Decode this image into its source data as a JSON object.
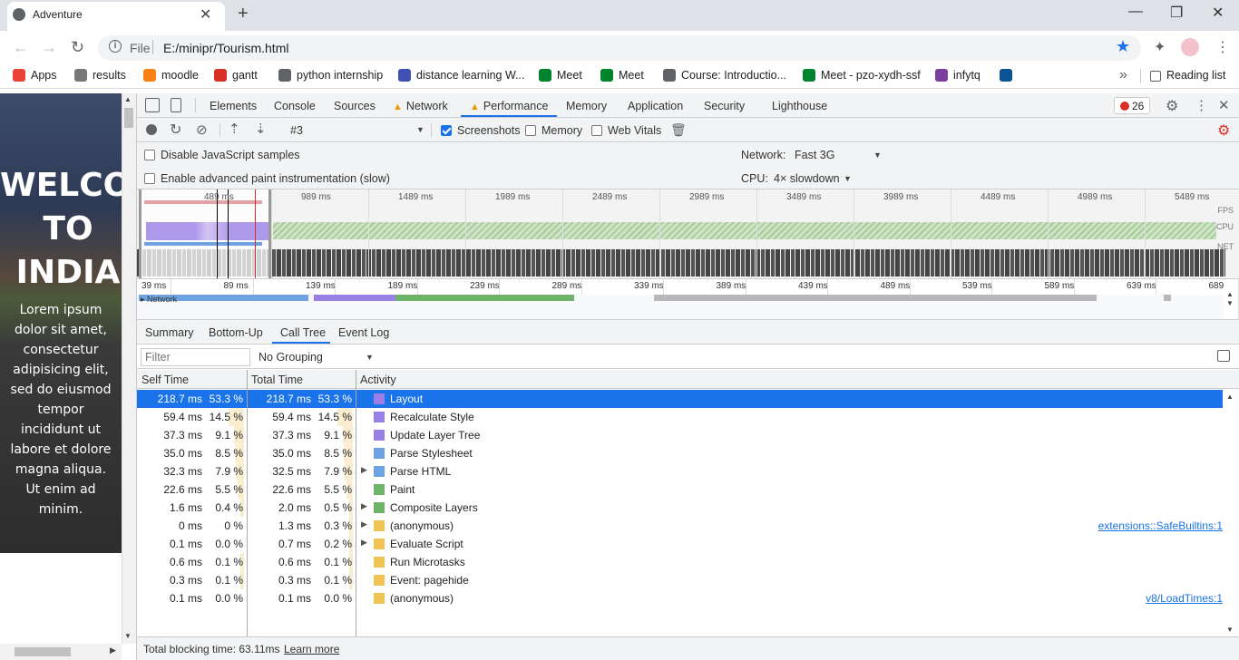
{
  "browser": {
    "tab_title": "Adventure",
    "tab_close": "✕",
    "new_tab": "+",
    "window_min": "—",
    "window_restore": "❐",
    "window_close": "✕",
    "url_scheme": "File",
    "url": "E:/minipr/Tourism.html",
    "bookmarks": [
      {
        "label": "Apps",
        "color": "#ea4335"
      },
      {
        "label": "results",
        "color": "#777777"
      },
      {
        "label": "moodle",
        "color": "#f98012"
      },
      {
        "label": "gantt",
        "color": "#d93025"
      },
      {
        "label": "python internship",
        "color": "#5f6368"
      },
      {
        "label": "distance learning W...",
        "color": "#3f51b5"
      },
      {
        "label": "Meet",
        "color": "#00832d"
      },
      {
        "label": "Meet",
        "color": "#00832d"
      },
      {
        "label": "Course: Introductio...",
        "color": "#5f6368"
      },
      {
        "label": "Meet - pzo-xydh-ssf",
        "color": "#00832d"
      },
      {
        "label": "infytq",
        "color": "#7b3fa0"
      },
      {
        "label": "",
        "color": "#0b5394"
      }
    ],
    "bookmarks_overflow": "»",
    "reading_list": "Reading list"
  },
  "page": {
    "heading": "WELCOME\nTO\nINDIA",
    "body": "Lorem ipsum dolor sit amet, consectetur adipisicing elit, sed do eiusmod tempor incididunt ut labore et dolore magna aliqua. Ut enim ad minim."
  },
  "devtools": {
    "tabs": [
      "Elements",
      "Console",
      "Sources",
      "Network",
      "Performance",
      "Memory",
      "Application",
      "Security",
      "Lighthouse"
    ],
    "active_tab": "Performance",
    "error_count": "26",
    "profile_select": "#3",
    "screenshots_label": "Screenshots",
    "memory_label": "Memory",
    "web_vitals_label": "Web Vitals",
    "disable_js_samples": "Disable JavaScript samples",
    "enable_paint": "Enable advanced paint instrumentation (slow)",
    "network_label": "Network:",
    "network_value": "Fast 3G",
    "cpu_label": "CPU:",
    "cpu_value": "4× slowdown",
    "overview_ticks": [
      "489 ms",
      "989 ms",
      "1489 ms",
      "1989 ms",
      "2489 ms",
      "2989 ms",
      "3489 ms",
      "3989 ms",
      "4489 ms",
      "4989 ms",
      "5489 ms"
    ],
    "overview_labels": [
      "FPS",
      "CPU",
      "NET"
    ],
    "ruler_ticks": [
      "39 ms",
      "89 ms",
      "139 ms",
      "189 ms",
      "239 ms",
      "289 ms",
      "339 ms",
      "389 ms",
      "439 ms",
      "489 ms",
      "539 ms",
      "589 ms",
      "639 ms",
      "689"
    ],
    "network_track": "▸ Network",
    "bottom_tabs": [
      "Summary",
      "Bottom-Up",
      "Call Tree",
      "Event Log"
    ],
    "active_bottom_tab": "Call Tree",
    "filter_placeholder": "Filter",
    "grouping": "No Grouping",
    "columns": {
      "self": "Self Time",
      "total": "Total Time",
      "activity": "Activity"
    },
    "rows": [
      {
        "self": "218.7 ms",
        "self_pct": "53.3 %",
        "total": "218.7 ms",
        "total_pct": "53.3 %",
        "activity": "Layout",
        "color": "#9a7fe6",
        "expand": false,
        "link": "",
        "self_frac": 0.533,
        "total_frac": 0.533,
        "selected": true
      },
      {
        "self": "59.4 ms",
        "self_pct": "14.5 %",
        "total": "59.4 ms",
        "total_pct": "14.5 %",
        "activity": "Recalculate Style",
        "color": "#9a7fe6",
        "expand": false,
        "link": "",
        "self_frac": 0.145,
        "total_frac": 0.145
      },
      {
        "self": "37.3 ms",
        "self_pct": "9.1 %",
        "total": "37.3 ms",
        "total_pct": "9.1 %",
        "activity": "Update Layer Tree",
        "color": "#9a7fe6",
        "expand": false,
        "link": "",
        "self_frac": 0.091,
        "total_frac": 0.091
      },
      {
        "self": "35.0 ms",
        "self_pct": "8.5 %",
        "total": "35.0 ms",
        "total_pct": "8.5 %",
        "activity": "Parse Stylesheet",
        "color": "#6fa2e0",
        "expand": false,
        "link": "",
        "self_frac": 0.085,
        "total_frac": 0.085
      },
      {
        "self": "32.3 ms",
        "self_pct": "7.9 %",
        "total": "32.5 ms",
        "total_pct": "7.9 %",
        "activity": "Parse HTML",
        "color": "#6fa2e0",
        "expand": true,
        "link": "",
        "self_frac": 0.079,
        "total_frac": 0.079
      },
      {
        "self": "22.6 ms",
        "self_pct": "5.5 %",
        "total": "22.6 ms",
        "total_pct": "5.5 %",
        "activity": "Paint",
        "color": "#6db36a",
        "expand": false,
        "link": "",
        "self_frac": 0.055,
        "total_frac": 0.055
      },
      {
        "self": "1.6 ms",
        "self_pct": "0.4 %",
        "total": "2.0 ms",
        "total_pct": "0.5 %",
        "activity": "Composite Layers",
        "color": "#6db36a",
        "expand": true,
        "link": "",
        "self_frac": 0.004,
        "total_frac": 0.005
      },
      {
        "self": "0 ms",
        "self_pct": "0 %",
        "total": "1.3 ms",
        "total_pct": "0.3 %",
        "activity": "(anonymous)",
        "color": "#f0c454",
        "expand": true,
        "link": "extensions::SafeBuiltins:1",
        "self_frac": 0,
        "total_frac": 0.003
      },
      {
        "self": "0.1 ms",
        "self_pct": "0.0 %",
        "total": "0.7 ms",
        "total_pct": "0.2 %",
        "activity": "Evaluate Script",
        "color": "#f0c454",
        "expand": true,
        "link": "",
        "self_frac": 0,
        "total_frac": 0.002
      },
      {
        "self": "0.6 ms",
        "self_pct": "0.1 %",
        "total": "0.6 ms",
        "total_pct": "0.1 %",
        "activity": "Run Microtasks",
        "color": "#f0c454",
        "expand": false,
        "link": "",
        "self_frac": 0.001,
        "total_frac": 0.001
      },
      {
        "self": "0.3 ms",
        "self_pct": "0.1 %",
        "total": "0.3 ms",
        "total_pct": "0.1 %",
        "activity": "Event: pagehide",
        "color": "#f0c454",
        "expand": false,
        "link": "",
        "self_frac": 0.001,
        "total_frac": 0.001
      },
      {
        "self": "0.1 ms",
        "self_pct": "0.0 %",
        "total": "0.1 ms",
        "total_pct": "0.0 %",
        "activity": "(anonymous)",
        "color": "#f0c454",
        "expand": false,
        "link": "v8/LoadTimes:1",
        "self_frac": 0,
        "total_frac": 0
      }
    ],
    "status_text": "Total blocking time: 63.11ms",
    "learn_more": "Learn more"
  }
}
